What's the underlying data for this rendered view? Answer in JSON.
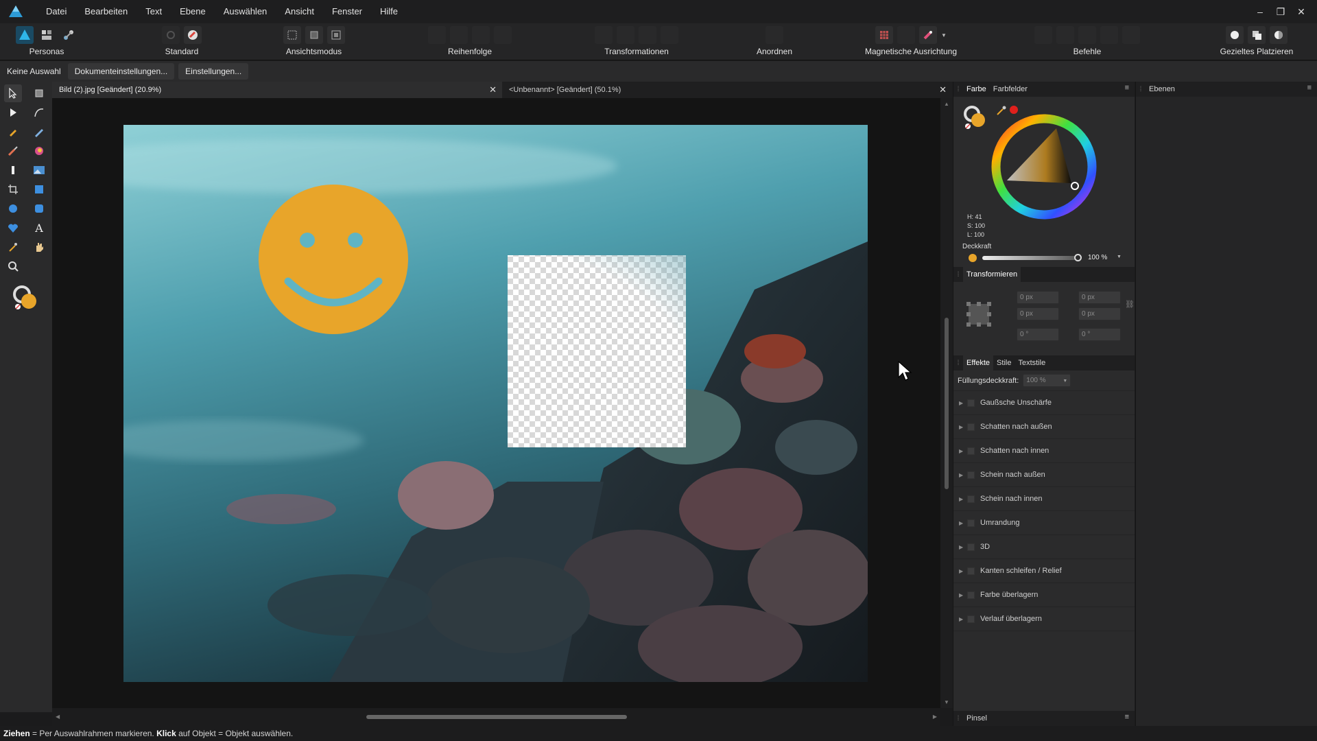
{
  "app": {
    "name": "Affinity Photo"
  },
  "menu": [
    "Datei",
    "Bearbeiten",
    "Text",
    "Ebene",
    "Auswählen",
    "Ansicht",
    "Fenster",
    "Hilfe"
  ],
  "window_controls": {
    "minimize": "–",
    "restore": "❐",
    "close": "✕"
  },
  "toolbar": {
    "personas": "Personas",
    "standard": "Standard",
    "ansichtsmodus": "Ansichtsmodus",
    "reihenfolge": "Reihenfolge",
    "transformationen": "Transformationen",
    "anordnen": "Anordnen",
    "magnetische": "Magnetische Ausrichtung",
    "befehle": "Befehle",
    "gezieltes": "Gezieltes Platzieren"
  },
  "context": {
    "selection": "Keine Auswahl",
    "doc_settings": "Dokumenteinstellungen...",
    "settings": "Einstellungen..."
  },
  "tabs": [
    {
      "label": "Bild (2).jpg [Geändert] (20.9%)",
      "close": "✕"
    },
    {
      "label": "<Unbenannt> [Geändert] (50.1%)",
      "close": "✕"
    }
  ],
  "color_panel": {
    "tab_farbe": "Farbe",
    "tab_farbfelder": "Farbfelder",
    "h": "H: 41",
    "s": "S: 100",
    "l": "L: 100",
    "opacity_label": "Deckkraft",
    "opacity_value": "100 %",
    "accent": "#e8a52a"
  },
  "transform_panel": {
    "title": "Transformieren",
    "x": "0 px",
    "y": "0 px",
    "w": "0 px",
    "h": "0 px",
    "r": "0 °",
    "s": "0 °"
  },
  "effects_panel": {
    "tab_effekte": "Effekte",
    "tab_stile": "Stile",
    "tab_textstile": "Textstile",
    "fill_label": "Füllungsdeckkraft:",
    "fill_value": "100 %",
    "items": [
      "Gaußsche Unschärfe",
      "Schatten nach außen",
      "Schatten nach innen",
      "Schein nach außen",
      "Schein nach innen",
      "Umrandung",
      "3D",
      "Kanten schleifen / Relief",
      "Farbe überlagern",
      "Verlauf überlagern"
    ]
  },
  "brush_panel": {
    "title": "Pinsel"
  },
  "layers_panel": {
    "title": "Ebenen"
  },
  "status": {
    "drag_bold": "Ziehen",
    "drag_text": " = Per Auswahlrahmen markieren. ",
    "click_bold": "Klick",
    "click_text": " auf Objekt = Objekt auswählen."
  }
}
